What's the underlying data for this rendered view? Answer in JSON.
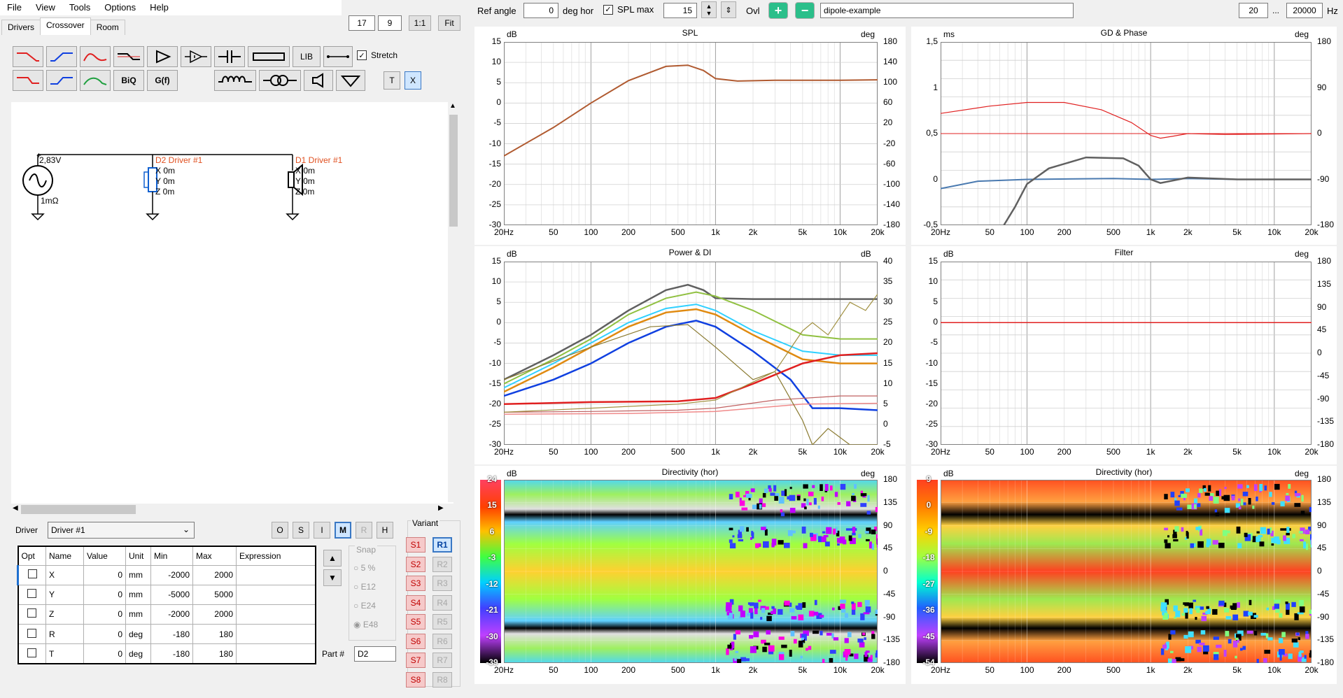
{
  "menu": [
    "File",
    "View",
    "Tools",
    "Options",
    "Help"
  ],
  "tabs": [
    "Drivers",
    "Crossover",
    "Room"
  ],
  "top_boxes": {
    "a": "17",
    "b": "9",
    "one": "1:1",
    "fit": "Fit"
  },
  "toolbar": {
    "lib": "LIB",
    "biq": "BiQ",
    "gf": "G(f)",
    "t": "T",
    "x": "X",
    "stretch": "Stretch"
  },
  "schematic": {
    "source_voltage": "2,83V",
    "source_r": "1mΩ",
    "d2": {
      "name": "D2 Driver #1",
      "x": "X 0m",
      "y": "Y 0m",
      "z": "Z 0m"
    },
    "d1": {
      "name": "D1 Driver #1",
      "x": "X 0m",
      "y": "Y 0m",
      "z": "Z 0m"
    }
  },
  "driver": {
    "label": "Driver",
    "value": "Driver #1"
  },
  "mode_buttons": [
    "O",
    "S",
    "I",
    "M",
    "R",
    "H"
  ],
  "params": {
    "headers": [
      "Opt",
      "Name",
      "Value",
      "Unit",
      "Min",
      "Max",
      "Expression"
    ],
    "rows": [
      {
        "name": "X",
        "value": "0",
        "unit": "mm",
        "min": "-2000",
        "max": "2000"
      },
      {
        "name": "Y",
        "value": "0",
        "unit": "mm",
        "min": "-5000",
        "max": "5000"
      },
      {
        "name": "Z",
        "value": "0",
        "unit": "mm",
        "min": "-2000",
        "max": "2000"
      },
      {
        "name": "R",
        "value": "0",
        "unit": "deg",
        "min": "-180",
        "max": "180"
      },
      {
        "name": "T",
        "value": "0",
        "unit": "deg",
        "min": "-180",
        "max": "180"
      }
    ]
  },
  "snap": {
    "title": "Snap",
    "options": [
      "5 %",
      "E12",
      "E24",
      "E48"
    ]
  },
  "part": {
    "label": "Part #",
    "value": "D2"
  },
  "variant": {
    "title": "Variant",
    "s": [
      "S1",
      "S2",
      "S3",
      "S4",
      "S5",
      "S6",
      "S7",
      "S8"
    ],
    "r": [
      "R1",
      "R2",
      "R3",
      "R4",
      "R5",
      "R6",
      "R7",
      "R8"
    ]
  },
  "topbar": {
    "ref_angle_label": "Ref angle",
    "ref_angle": "0",
    "deg_hor": "deg hor",
    "spl_max_label": "SPL max",
    "spl_max": "15",
    "ovl": "Ovl",
    "project": "dipole-example",
    "f_min": "20",
    "dots": "...",
    "f_max": "20000",
    "hz": "Hz"
  },
  "x_ticks": [
    "20Hz",
    "50",
    "100",
    "200",
    "500",
    "1k",
    "2k",
    "5k",
    "10k",
    "20k"
  ],
  "plots": {
    "spl": {
      "title": "SPL",
      "left_unit": "dB",
      "right_unit": "deg",
      "left": [
        "15",
        "10",
        "5",
        "0",
        "-5",
        "-10",
        "-15",
        "-20",
        "-25",
        "-30"
      ],
      "right": [
        "180",
        "140",
        "100",
        "60",
        "20",
        "-20",
        "-60",
        "-100",
        "-140",
        "-180"
      ]
    },
    "gd": {
      "title": "GD & Phase",
      "left_unit": "ms",
      "right_unit": "deg",
      "left": [
        "1,5",
        "1",
        "0,5",
        "0",
        "-0,5"
      ],
      "right": [
        "180",
        "90",
        "0",
        "-90",
        "-180"
      ]
    },
    "power": {
      "title": "Power & DI",
      "left_unit": "dB",
      "right_unit": "dB",
      "left": [
        "15",
        "10",
        "5",
        "0",
        "-5",
        "-10",
        "-15",
        "-20",
        "-25",
        "-30"
      ],
      "right": [
        "40",
        "35",
        "30",
        "25",
        "20",
        "15",
        "10",
        "5",
        "0",
        "-5"
      ]
    },
    "filter": {
      "title": "Filter",
      "left_unit": "dB",
      "right_unit": "deg",
      "left": [
        "15",
        "10",
        "5",
        "0",
        "-5",
        "-10",
        "-15",
        "-20",
        "-25",
        "-30"
      ],
      "right": [
        "180",
        "135",
        "90",
        "45",
        "0",
        "-45",
        "-90",
        "-135",
        "-180"
      ]
    },
    "dir1": {
      "title": "Directivity (hor)",
      "left_unit": "dB",
      "right_unit": "deg",
      "scale": [
        "24",
        "15",
        "6",
        "-3",
        "-12",
        "-21",
        "-30",
        "-39"
      ],
      "right": [
        "180",
        "135",
        "90",
        "45",
        "0",
        "-45",
        "-90",
        "-135",
        "-180"
      ]
    },
    "dir2": {
      "title": "Directivity (hor)",
      "left_unit": "dB",
      "right_unit": "deg",
      "scale": [
        "9",
        "0",
        "-9",
        "-18",
        "-27",
        "-36",
        "-45",
        "-54"
      ],
      "right": [
        "180",
        "135",
        "90",
        "45",
        "0",
        "-45",
        "-90",
        "-135",
        "-180"
      ]
    }
  },
  "colors": {
    "red": "#e02020",
    "blue": "#1040e0",
    "grey": "#606060",
    "brown": "#b05a30",
    "cyan": "#30d0ff",
    "olive": "#90c040",
    "orange": "#e08a10"
  }
}
